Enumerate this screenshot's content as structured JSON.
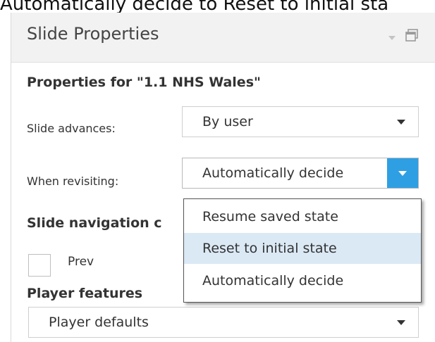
{
  "caption": "Automatically decide  to  Reset to initial sta",
  "panel": {
    "title": "Slide Properties",
    "icons": [
      "collapse-arrow-icon",
      "float-window-icon"
    ]
  },
  "properties_heading": "Properties for \"1.1 NHS Wales\"",
  "slide_advances": {
    "label": "Slide advances:",
    "value": "By user"
  },
  "when_revisiting": {
    "label": "When revisiting:",
    "value": "Automatically decide",
    "options": [
      "Resume saved state",
      "Reset to initial state",
      "Automatically decide"
    ],
    "highlighted_index": 1
  },
  "slide_navigation": {
    "heading": "Slide navigation c",
    "prev_label": "Prev",
    "prev_checked": false
  },
  "player_features": {
    "heading": "Player features",
    "value": "Player defaults"
  },
  "colors": {
    "accent": "#2f9fe3",
    "highlight": "#dbe9f5"
  }
}
